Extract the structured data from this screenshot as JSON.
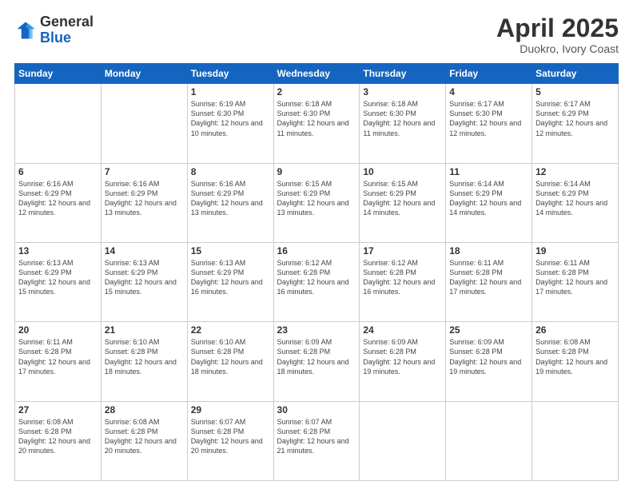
{
  "logo": {
    "general": "General",
    "blue": "Blue"
  },
  "title": "April 2025",
  "location": "Duokro, Ivory Coast",
  "days_header": [
    "Sunday",
    "Monday",
    "Tuesday",
    "Wednesday",
    "Thursday",
    "Friday",
    "Saturday"
  ],
  "weeks": [
    [
      {
        "day": "",
        "info": ""
      },
      {
        "day": "",
        "info": ""
      },
      {
        "day": "1",
        "info": "Sunrise: 6:19 AM\nSunset: 6:30 PM\nDaylight: 12 hours and 10 minutes."
      },
      {
        "day": "2",
        "info": "Sunrise: 6:18 AM\nSunset: 6:30 PM\nDaylight: 12 hours and 11 minutes."
      },
      {
        "day": "3",
        "info": "Sunrise: 6:18 AM\nSunset: 6:30 PM\nDaylight: 12 hours and 11 minutes."
      },
      {
        "day": "4",
        "info": "Sunrise: 6:17 AM\nSunset: 6:30 PM\nDaylight: 12 hours and 12 minutes."
      },
      {
        "day": "5",
        "info": "Sunrise: 6:17 AM\nSunset: 6:29 PM\nDaylight: 12 hours and 12 minutes."
      }
    ],
    [
      {
        "day": "6",
        "info": "Sunrise: 6:16 AM\nSunset: 6:29 PM\nDaylight: 12 hours and 12 minutes."
      },
      {
        "day": "7",
        "info": "Sunrise: 6:16 AM\nSunset: 6:29 PM\nDaylight: 12 hours and 13 minutes."
      },
      {
        "day": "8",
        "info": "Sunrise: 6:16 AM\nSunset: 6:29 PM\nDaylight: 12 hours and 13 minutes."
      },
      {
        "day": "9",
        "info": "Sunrise: 6:15 AM\nSunset: 6:29 PM\nDaylight: 12 hours and 13 minutes."
      },
      {
        "day": "10",
        "info": "Sunrise: 6:15 AM\nSunset: 6:29 PM\nDaylight: 12 hours and 14 minutes."
      },
      {
        "day": "11",
        "info": "Sunrise: 6:14 AM\nSunset: 6:29 PM\nDaylight: 12 hours and 14 minutes."
      },
      {
        "day": "12",
        "info": "Sunrise: 6:14 AM\nSunset: 6:29 PM\nDaylight: 12 hours and 14 minutes."
      }
    ],
    [
      {
        "day": "13",
        "info": "Sunrise: 6:13 AM\nSunset: 6:29 PM\nDaylight: 12 hours and 15 minutes."
      },
      {
        "day": "14",
        "info": "Sunrise: 6:13 AM\nSunset: 6:29 PM\nDaylight: 12 hours and 15 minutes."
      },
      {
        "day": "15",
        "info": "Sunrise: 6:13 AM\nSunset: 6:29 PM\nDaylight: 12 hours and 16 minutes."
      },
      {
        "day": "16",
        "info": "Sunrise: 6:12 AM\nSunset: 6:28 PM\nDaylight: 12 hours and 16 minutes."
      },
      {
        "day": "17",
        "info": "Sunrise: 6:12 AM\nSunset: 6:28 PM\nDaylight: 12 hours and 16 minutes."
      },
      {
        "day": "18",
        "info": "Sunrise: 6:11 AM\nSunset: 6:28 PM\nDaylight: 12 hours and 17 minutes."
      },
      {
        "day": "19",
        "info": "Sunrise: 6:11 AM\nSunset: 6:28 PM\nDaylight: 12 hours and 17 minutes."
      }
    ],
    [
      {
        "day": "20",
        "info": "Sunrise: 6:11 AM\nSunset: 6:28 PM\nDaylight: 12 hours and 17 minutes."
      },
      {
        "day": "21",
        "info": "Sunrise: 6:10 AM\nSunset: 6:28 PM\nDaylight: 12 hours and 18 minutes."
      },
      {
        "day": "22",
        "info": "Sunrise: 6:10 AM\nSunset: 6:28 PM\nDaylight: 12 hours and 18 minutes."
      },
      {
        "day": "23",
        "info": "Sunrise: 6:09 AM\nSunset: 6:28 PM\nDaylight: 12 hours and 18 minutes."
      },
      {
        "day": "24",
        "info": "Sunrise: 6:09 AM\nSunset: 6:28 PM\nDaylight: 12 hours and 19 minutes."
      },
      {
        "day": "25",
        "info": "Sunrise: 6:09 AM\nSunset: 6:28 PM\nDaylight: 12 hours and 19 minutes."
      },
      {
        "day": "26",
        "info": "Sunrise: 6:08 AM\nSunset: 6:28 PM\nDaylight: 12 hours and 19 minutes."
      }
    ],
    [
      {
        "day": "27",
        "info": "Sunrise: 6:08 AM\nSunset: 6:28 PM\nDaylight: 12 hours and 20 minutes."
      },
      {
        "day": "28",
        "info": "Sunrise: 6:08 AM\nSunset: 6:28 PM\nDaylight: 12 hours and 20 minutes."
      },
      {
        "day": "29",
        "info": "Sunrise: 6:07 AM\nSunset: 6:28 PM\nDaylight: 12 hours and 20 minutes."
      },
      {
        "day": "30",
        "info": "Sunrise: 6:07 AM\nSunset: 6:28 PM\nDaylight: 12 hours and 21 minutes."
      },
      {
        "day": "",
        "info": ""
      },
      {
        "day": "",
        "info": ""
      },
      {
        "day": "",
        "info": ""
      }
    ]
  ]
}
